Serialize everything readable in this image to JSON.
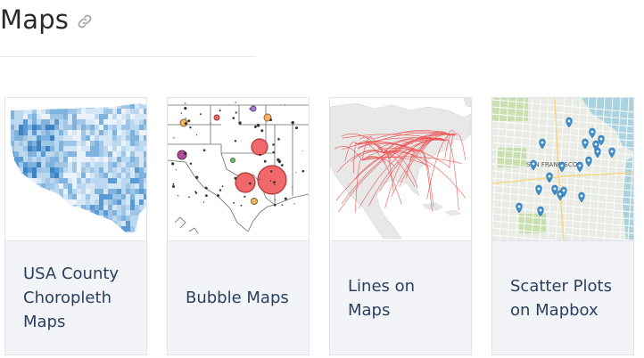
{
  "section": {
    "title": "Maps",
    "link_icon": "link-icon"
  },
  "cards": [
    {
      "label": "USA County\nChoropleth\nMaps",
      "thumbnail": "choropleth-thumbnail"
    },
    {
      "label": "Bubble Maps",
      "thumbnail": "bubble-map-thumbnail"
    },
    {
      "label": "Lines on\nMaps",
      "thumbnail": "lines-map-thumbnail"
    },
    {
      "label": "Scatter Plots\non Mapbox",
      "thumbnail": "mapbox-thumbnail"
    }
  ],
  "mapbox_labels": [
    "SAN FRANCISCO"
  ],
  "colors": {
    "choropleth": "#5b9bd5",
    "bubble": "#f0686a",
    "lines": "#ee3a3a",
    "mapbox_marker": "#3d8fd1"
  }
}
